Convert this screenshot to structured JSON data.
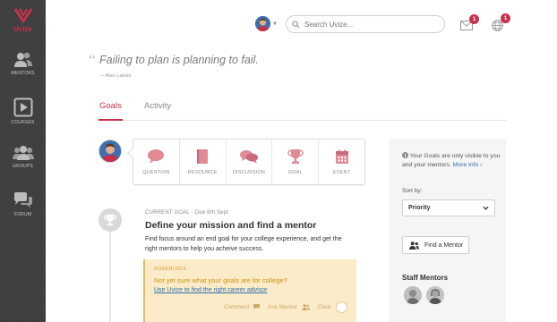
{
  "brand": {
    "name": "Uvize",
    "accent": "#c8304a"
  },
  "sidebar": {
    "items": [
      {
        "label": "MENTORS",
        "icon": "mentors-icon"
      },
      {
        "label": "COURSES",
        "icon": "play-icon"
      },
      {
        "label": "GROUPS",
        "icon": "groups-icon"
      },
      {
        "label": "FORUM",
        "icon": "forum-icon"
      }
    ]
  },
  "header": {
    "search_placeholder": "Search Uvize...",
    "messages_badge": "1",
    "notifications_badge": "1"
  },
  "quote": {
    "text": "Failing to plan is planning to fail.",
    "author": "— Alan Lakein"
  },
  "tabs": [
    {
      "label": "Goals",
      "active": true
    },
    {
      "label": "Activity",
      "active": false
    }
  ],
  "actions": [
    {
      "label": "QUESTION",
      "icon": "speech-bubble-icon"
    },
    {
      "label": "RESOURCE",
      "icon": "book-icon"
    },
    {
      "label": "DISCUSSION",
      "icon": "discussion-icon"
    },
    {
      "label": "GOAL",
      "icon": "trophy-icon"
    },
    {
      "label": "EVENT",
      "icon": "calendar-icon"
    }
  ],
  "current_goal": {
    "label": "CURRENT GOAL",
    "due": "· Due 6th Sept",
    "title": "Define your mission and find a mentor",
    "description": "Find focus around an end goal for your college experience, and get the right mentors to help you acheive success."
  },
  "roadblock": {
    "label": "ROADBLOCK",
    "question": "Not yet sure what your goals are for college?",
    "link": "Use Uvize to find the right career advisor",
    "actions": {
      "comment": "Comment",
      "ask": "Ask Mentor",
      "clear": "Clear"
    }
  },
  "panel": {
    "info": "Your Goals are only visible to you and your mentors.",
    "more_info": "More Info ›",
    "sort_label": "Sort by:",
    "sort_value": "Priority",
    "find_mentor": "Find a Mentor",
    "staff_title": "Staff Mentors"
  }
}
